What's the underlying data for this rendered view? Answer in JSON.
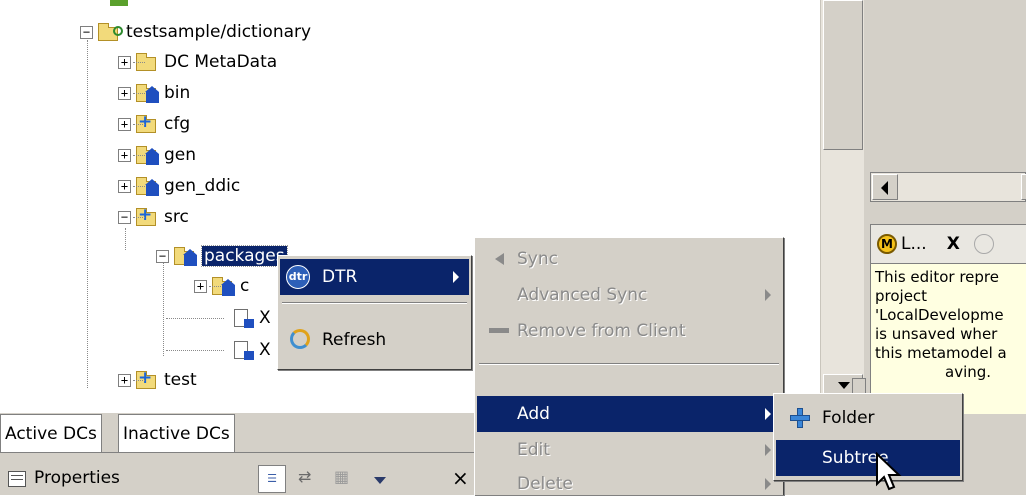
{
  "tree": {
    "project": "testsample/dictionary",
    "items": [
      "DC MetaData",
      "bin",
      "cfg",
      "gen",
      "gen_ddic",
      "src"
    ],
    "packages": "packages",
    "child_c": "c",
    "child_x1": "X",
    "child_x2": "X",
    "test": "test"
  },
  "tabs": {
    "active": "Active DCs",
    "inactive": "Inactive DCs"
  },
  "properties": {
    "title": "Properties",
    "close": "×"
  },
  "context_menu": {
    "dtr": "DTR",
    "dtr_logo": "dtr",
    "refresh": "Refresh"
  },
  "dtr_menu": {
    "sync": "Sync",
    "advanced_sync": "Advanced Sync",
    "remove": "Remove from Client",
    "add": "Add",
    "edit": "Edit",
    "delete": "Delete"
  },
  "add_menu": {
    "folder": "Folder",
    "subtree": "Subtree"
  },
  "right_panel": {
    "tab_label": "L...",
    "tab_close": "X",
    "tab_icon_letter": "M",
    "lines": [
      "This editor repre",
      "project",
      "'LocalDevelopme",
      "is unsaved wher",
      "this metamodel a",
      "aving."
    ]
  },
  "colors": {
    "selection": "#0a246a",
    "menu_bg": "#d4d0c8"
  }
}
